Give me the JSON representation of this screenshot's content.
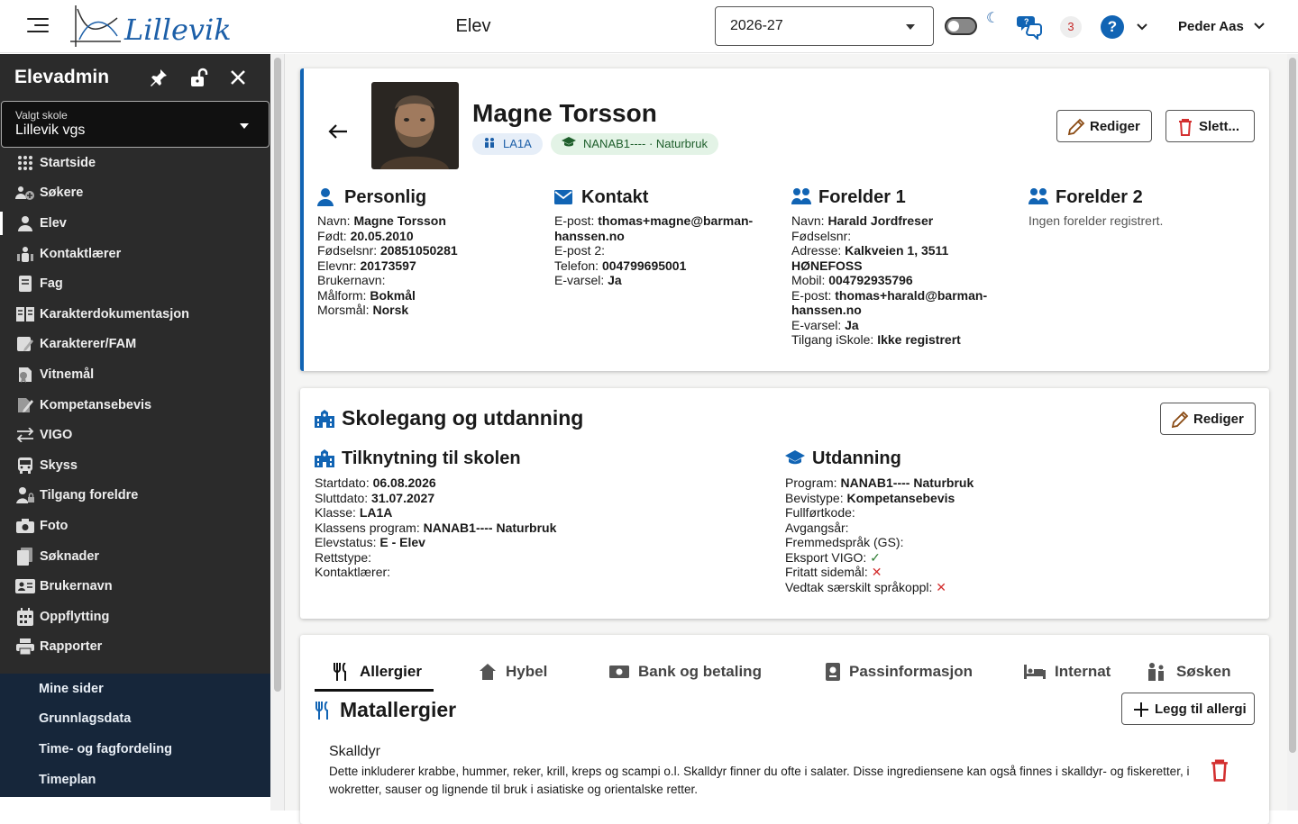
{
  "topbar": {
    "logo_text": "Lillevik",
    "page_title": "Elev",
    "year_value": "2026-27",
    "notification_count": "3",
    "help_label": "?",
    "user_name": "Peder Aas"
  },
  "sidebar": {
    "title": "Elevadmin",
    "school_label": "Valgt skole",
    "school_value": "Lillevik vgs",
    "items": [
      {
        "label": "Startside",
        "icon": "grid-icon"
      },
      {
        "label": "Søkere",
        "icon": "users-plus-icon"
      },
      {
        "label": "Elev",
        "icon": "person-icon"
      },
      {
        "label": "Kontaktlærer",
        "icon": "teacher-icon"
      },
      {
        "label": "Fag",
        "icon": "book-icon"
      },
      {
        "label": "Karakterdokumentasjon",
        "icon": "document-icon"
      },
      {
        "label": "Karakterer/FAM",
        "icon": "edit-book-icon"
      },
      {
        "label": "Vitnemål",
        "icon": "certificate-icon"
      },
      {
        "label": "Kompetansebevis",
        "icon": "pen-doc-icon"
      },
      {
        "label": "VIGO",
        "icon": "transfer-icon"
      },
      {
        "label": "Skyss",
        "icon": "bus-icon"
      },
      {
        "label": "Tilgang foreldre",
        "icon": "person-lock-icon"
      },
      {
        "label": "Foto",
        "icon": "camera-icon"
      },
      {
        "label": "Søknader",
        "icon": "files-icon"
      },
      {
        "label": "Brukernavn",
        "icon": "id-card-icon"
      },
      {
        "label": "Oppflytting",
        "icon": "calendar-icon"
      },
      {
        "label": "Rapporter",
        "icon": "printer-icon"
      }
    ],
    "sub_items": [
      "Mine sider",
      "Grunnlagsdata",
      "Time- og fagfordeling",
      "Timeplan"
    ]
  },
  "student": {
    "name": "Magne Torsson",
    "class_chip": "LA1A",
    "program_chip": "NANAB1---- · Naturbruk",
    "edit_label": "Rediger",
    "delete_label": "Slett...",
    "personal": {
      "title": "Personlig",
      "rows": [
        {
          "k": "Navn:",
          "v": "Magne Torsson"
        },
        {
          "k": "Født:",
          "v": "20.05.2010"
        },
        {
          "k": "Fødselsnr:",
          "v": "20851050281"
        },
        {
          "k": "Elevnr:",
          "v": "20173597"
        },
        {
          "k": "Brukernavn:",
          "v": ""
        },
        {
          "k": "Målform:",
          "v": "Bokmål"
        },
        {
          "k": "Morsmål:",
          "v": "Norsk"
        }
      ]
    },
    "contact": {
      "title": "Kontakt",
      "rows": [
        {
          "k": "E-post:",
          "v": "thomas+magne@barman-hanssen.no"
        },
        {
          "k": "E-post 2:",
          "v": ""
        },
        {
          "k": "Telefon:",
          "v": "004799695001"
        },
        {
          "k": "E-varsel:",
          "v": "Ja"
        }
      ]
    },
    "parent1": {
      "title": "Forelder 1",
      "rows": [
        {
          "k": "Navn:",
          "v": "Harald Jordfreser"
        },
        {
          "k": "Fødselsnr:",
          "v": ""
        },
        {
          "k": "Adresse:",
          "v": "Kalkveien 1, 3511 HØNEFOSS"
        },
        {
          "k": "Mobil:",
          "v": "004792935796"
        },
        {
          "k": "E-post:",
          "v": "thomas+harald@barman-hanssen.no"
        },
        {
          "k": "E-varsel:",
          "v": "Ja"
        },
        {
          "k": "Tilgang iSkole:",
          "v": "Ikke registrert"
        }
      ]
    },
    "parent2": {
      "title": "Forelder 2",
      "empty": "Ingen forelder registrert."
    }
  },
  "schooling": {
    "title": "Skolegang og utdanning",
    "edit_label": "Rediger",
    "attachment": {
      "title": "Tilknytning til skolen",
      "rows": [
        {
          "k": "Startdato:",
          "v": "06.08.2026"
        },
        {
          "k": "Sluttdato:",
          "v": "31.07.2027"
        },
        {
          "k": "Klasse:",
          "v": "LA1A"
        },
        {
          "k": "Klassens program:",
          "v": "NANAB1---- Naturbruk"
        },
        {
          "k": "Elevstatus:",
          "v": "E - Elev"
        },
        {
          "k": "Rettstype:",
          "v": ""
        },
        {
          "k": "Kontaktlærer:",
          "v": ""
        }
      ]
    },
    "education": {
      "title": "Utdanning",
      "rows": [
        {
          "k": "Program:",
          "v": "NANAB1---- Naturbruk"
        },
        {
          "k": "Bevistype:",
          "v": "Kompetansebevis"
        },
        {
          "k": "Fullførtkode:",
          "v": ""
        },
        {
          "k": "Avgangsår:",
          "v": ""
        },
        {
          "k": "Fremmedspråk (GS):",
          "v": ""
        }
      ],
      "flags": [
        {
          "k": "Eksport VIGO:",
          "mark": "✓",
          "state": "yes"
        },
        {
          "k": "Fritatt sidemål:",
          "mark": "✕",
          "state": "no"
        },
        {
          "k": "Vedtak særskilt språkoppl:",
          "mark": "✕",
          "state": "no"
        }
      ]
    }
  },
  "tabs": [
    {
      "label": "Allergier",
      "icon": "cutlery-icon",
      "active": true
    },
    {
      "label": "Hybel",
      "icon": "house-icon",
      "active": false
    },
    {
      "label": "Bank og betaling",
      "icon": "money-icon",
      "active": false
    },
    {
      "label": "Passinformasjon",
      "icon": "passport-icon",
      "active": false
    },
    {
      "label": "Internat",
      "icon": "bed-icon",
      "active": false
    },
    {
      "label": "Søsken",
      "icon": "siblings-icon",
      "active": false
    }
  ],
  "allergies": {
    "title": "Matallergier",
    "add_label": "Legg til allergi",
    "items": [
      {
        "name": "Skalldyr",
        "description": "Dette inkluderer krabbe, hummer, reker, krill, kreps og scampi o.l. Skalldyr finner du ofte i salater. Disse ingrediensene kan også finnes i skalldyr- og fiskeretter, i wokretter, sauser og lignende til bruk i asiatiske og orientalske retter."
      }
    ]
  },
  "colors": {
    "accent": "#1164b4",
    "sidebar_bg": "#2b2b2b",
    "sidebar_sub_bg": "#16263a",
    "delete_red": "#d32f2f",
    "check_green": "#2e7d32"
  }
}
